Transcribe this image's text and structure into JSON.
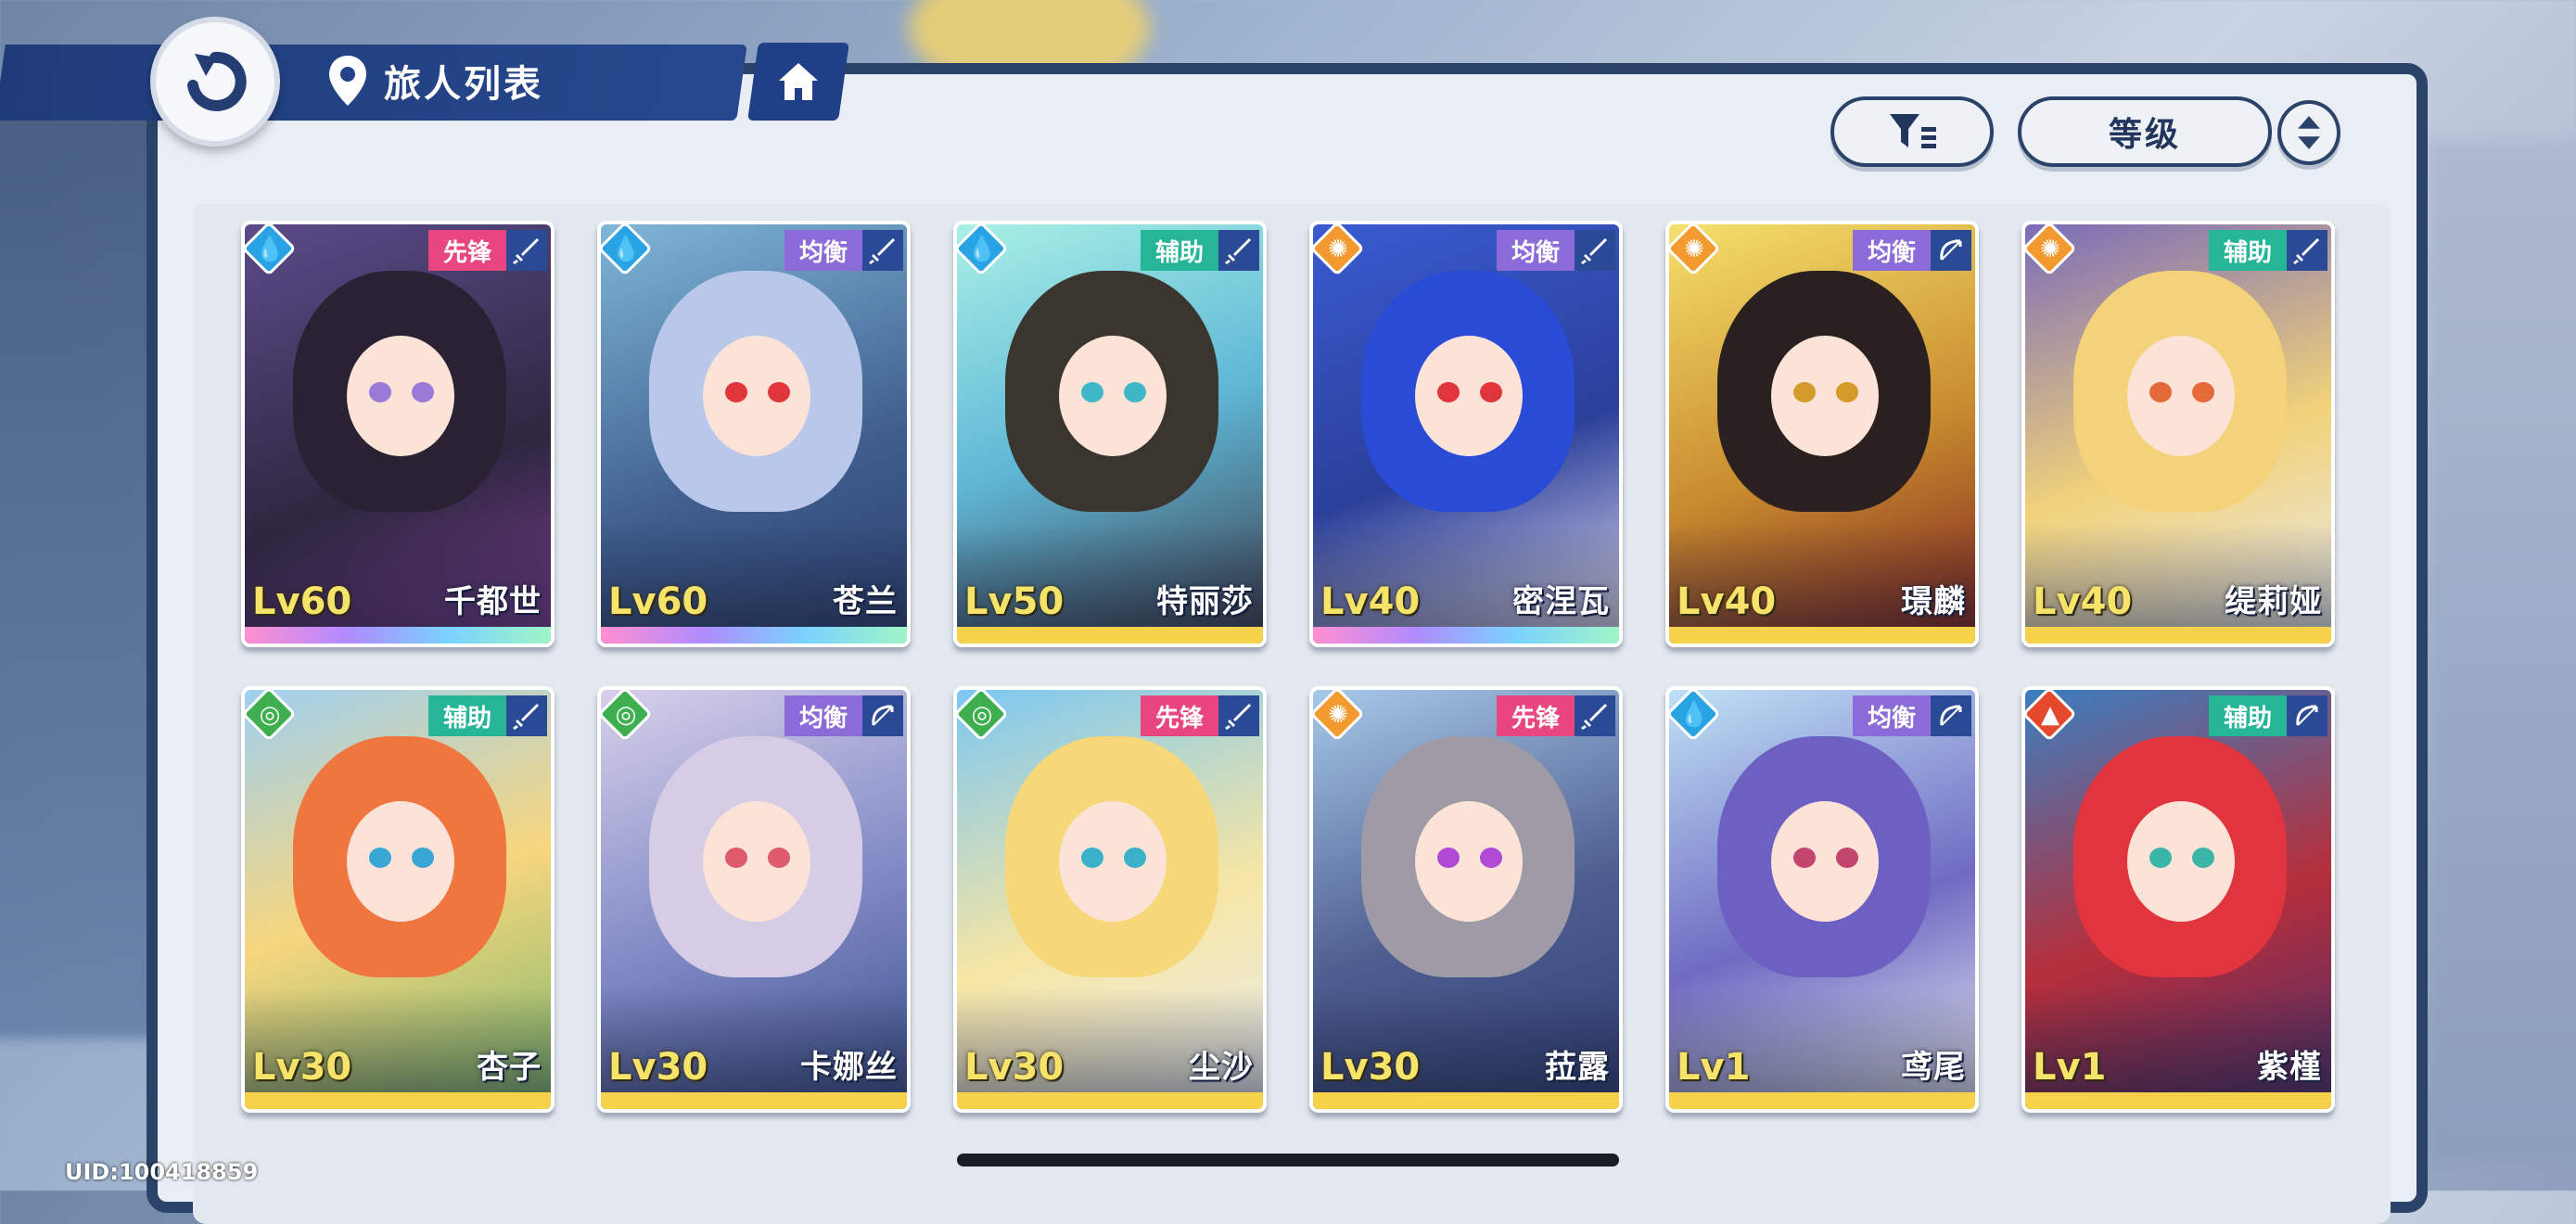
{
  "header": {
    "title": "旅人列表"
  },
  "controls": {
    "sort_label": "等级"
  },
  "footer": {
    "uid": "UID:100418859"
  },
  "colors": {
    "panel_border": "#2c4369",
    "header_blue": "#1f3c7a",
    "water": "#2aa3e4",
    "light": "#f29a30",
    "wind": "#3fae4f",
    "fire": "#e4492e",
    "role_vanguard": "#e8467f",
    "role_balanced": "#8b6bd8",
    "role_support": "#26b596",
    "rarity_rainbow": "linear-gradient(90deg,#ff8fd0,#b08bff,#7ad2ff,#9ff5c6)",
    "rarity_gold": "#f6d24a"
  },
  "characters": [
    {
      "name": "千都世",
      "level": "Lv60",
      "role": "先锋",
      "element": "water-icon",
      "weapon": "sword-icon",
      "rarity": "rainbow"
    },
    {
      "name": "苍兰",
      "level": "Lv60",
      "role": "均衡",
      "element": "water-icon",
      "weapon": "sword-icon",
      "rarity": "rainbow"
    },
    {
      "name": "特丽莎",
      "level": "Lv50",
      "role": "辅助",
      "element": "water-icon",
      "weapon": "sword-icon",
      "rarity": "gold"
    },
    {
      "name": "密涅瓦",
      "level": "Lv40",
      "role": "均衡",
      "element": "light-icon",
      "weapon": "sword-icon",
      "rarity": "rainbow"
    },
    {
      "name": "璟麟",
      "level": "Lv40",
      "role": "均衡",
      "element": "light-icon",
      "weapon": "bow-icon",
      "rarity": "gold"
    },
    {
      "name": "缇莉娅",
      "level": "Lv40",
      "role": "辅助",
      "element": "light-icon",
      "weapon": "sword-icon",
      "rarity": "gold"
    },
    {
      "name": "杏子",
      "level": "Lv30",
      "role": "辅助",
      "element": "wind-icon",
      "weapon": "sword-icon",
      "rarity": "gold"
    },
    {
      "name": "卡娜丝",
      "level": "Lv30",
      "role": "均衡",
      "element": "wind-icon",
      "weapon": "bow-icon",
      "rarity": "gold"
    },
    {
      "name": "尘沙",
      "level": "Lv30",
      "role": "先锋",
      "element": "wind-icon",
      "weapon": "sword-icon",
      "rarity": "gold"
    },
    {
      "name": "菈露",
      "level": "Lv30",
      "role": "先锋",
      "element": "light-icon",
      "weapon": "sword-icon",
      "rarity": "gold"
    },
    {
      "name": "鸢尾",
      "level": "Lv1",
      "role": "均衡",
      "element": "water-icon",
      "weapon": "bow-icon",
      "rarity": "gold"
    },
    {
      "name": "紫槿",
      "level": "Lv1",
      "role": "辅助",
      "element": "fire-icon",
      "weapon": "bow-icon",
      "rarity": "gold"
    }
  ]
}
